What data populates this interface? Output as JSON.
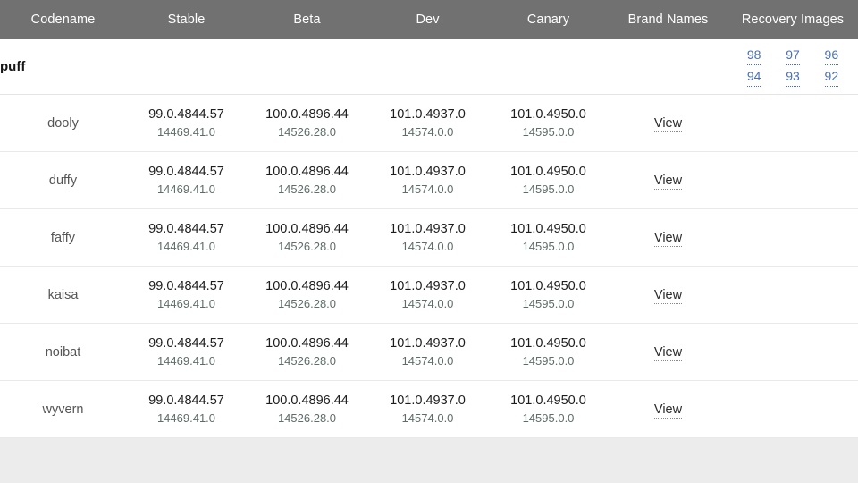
{
  "table": {
    "columns": [
      {
        "key": "codename",
        "label": "Codename"
      },
      {
        "key": "stable",
        "label": "Stable"
      },
      {
        "key": "beta",
        "label": "Beta"
      },
      {
        "key": "dev",
        "label": "Dev"
      },
      {
        "key": "canary",
        "label": "Canary"
      },
      {
        "key": "brand",
        "label": "Brand Names"
      },
      {
        "key": "recovery",
        "label": "Recovery Images"
      }
    ],
    "group": {
      "name": "puff",
      "recovery_images": [
        "98",
        "97",
        "96",
        "94",
        "93",
        "92"
      ]
    },
    "brand_link_label": "View",
    "rows": [
      {
        "codename": "dooly",
        "stable": {
          "version": "99.0.4844.57",
          "platform": "14469.41.0"
        },
        "beta": {
          "version": "100.0.4896.44",
          "platform": "14526.28.0"
        },
        "dev": {
          "version": "101.0.4937.0",
          "platform": "14574.0.0"
        },
        "canary": {
          "version": "101.0.4950.0",
          "platform": "14595.0.0"
        },
        "brand": "View"
      },
      {
        "codename": "duffy",
        "stable": {
          "version": "99.0.4844.57",
          "platform": "14469.41.0"
        },
        "beta": {
          "version": "100.0.4896.44",
          "platform": "14526.28.0"
        },
        "dev": {
          "version": "101.0.4937.0",
          "platform": "14574.0.0"
        },
        "canary": {
          "version": "101.0.4950.0",
          "platform": "14595.0.0"
        },
        "brand": "View"
      },
      {
        "codename": "faffy",
        "stable": {
          "version": "99.0.4844.57",
          "platform": "14469.41.0"
        },
        "beta": {
          "version": "100.0.4896.44",
          "platform": "14526.28.0"
        },
        "dev": {
          "version": "101.0.4937.0",
          "platform": "14574.0.0"
        },
        "canary": {
          "version": "101.0.4950.0",
          "platform": "14595.0.0"
        },
        "brand": "View"
      },
      {
        "codename": "kaisa",
        "stable": {
          "version": "99.0.4844.57",
          "platform": "14469.41.0"
        },
        "beta": {
          "version": "100.0.4896.44",
          "platform": "14526.28.0"
        },
        "dev": {
          "version": "101.0.4937.0",
          "platform": "14574.0.0"
        },
        "canary": {
          "version": "101.0.4950.0",
          "platform": "14595.0.0"
        },
        "brand": "View"
      },
      {
        "codename": "noibat",
        "stable": {
          "version": "99.0.4844.57",
          "platform": "14469.41.0"
        },
        "beta": {
          "version": "100.0.4896.44",
          "platform": "14526.28.0"
        },
        "dev": {
          "version": "101.0.4937.0",
          "platform": "14574.0.0"
        },
        "canary": {
          "version": "101.0.4950.0",
          "platform": "14595.0.0"
        },
        "brand": "View"
      },
      {
        "codename": "wyvern",
        "stable": {
          "version": "99.0.4844.57",
          "platform": "14469.41.0"
        },
        "beta": {
          "version": "100.0.4896.44",
          "platform": "14526.28.0"
        },
        "dev": {
          "version": "101.0.4937.0",
          "platform": "14574.0.0"
        },
        "canary": {
          "version": "101.0.4950.0",
          "platform": "14595.0.0"
        },
        "brand": "View"
      }
    ]
  },
  "colors": {
    "header_background": "#717171",
    "header_text": "#ffffff",
    "version_highlight": "#7df0c6",
    "link_blue": "#4a6fb5",
    "page_background": "#ececec",
    "table_background": "#ffffff"
  }
}
